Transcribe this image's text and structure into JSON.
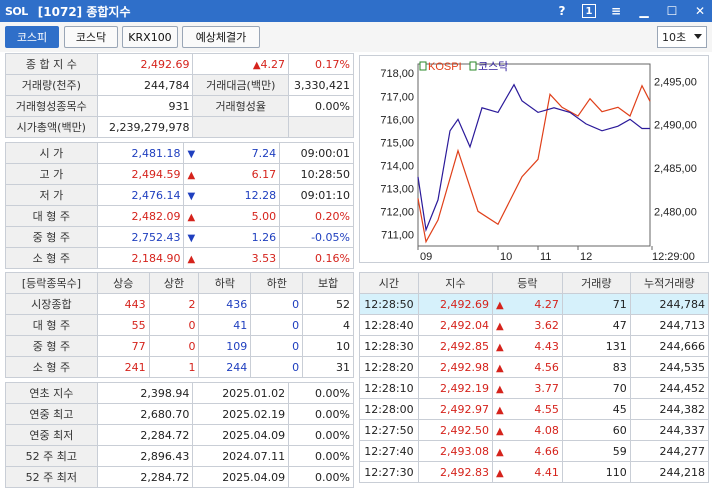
{
  "title": {
    "logo": "SOL",
    "screen": "[1072] 종합지수",
    "help": "?",
    "num": "1",
    "menu": "≡"
  },
  "tabs": [
    {
      "label": "코스피",
      "active": true
    },
    {
      "label": "코스닥"
    },
    {
      "label": "KRX100"
    },
    {
      "label": "예상체결가"
    }
  ],
  "interval": "10초",
  "summary": {
    "index_label": "종 합 지 수",
    "index_value": "2,492.69",
    "index_change": "4.27",
    "index_pct": "0.17%",
    "vol_label": "거래량(천주)",
    "vol_value": "244,784",
    "amt_label": "거래대금(백만)",
    "amt_value": "3,330,421",
    "form_cnt_label": "거래형성종목수",
    "form_cnt_value": "931",
    "form_rate_label": "거래형성율",
    "form_rate_value": "0.00%",
    "mktcap_label": "시가총액(백만)",
    "mktcap_value": "2,239,279,978"
  },
  "prices": [
    {
      "label": "시   가",
      "value": "2,481.18",
      "dir": "down",
      "change": "7.24",
      "time": "09:00:01",
      "vcolor": "blue"
    },
    {
      "label": "고   가",
      "value": "2,494.59",
      "dir": "up",
      "change": "6.17",
      "time": "10:28:50",
      "vcolor": "red"
    },
    {
      "label": "저   가",
      "value": "2,476.14",
      "dir": "down",
      "change": "12.28",
      "time": "09:01:10",
      "vcolor": "blue"
    },
    {
      "label": "대 형 주",
      "value": "2,482.09",
      "dir": "up",
      "change": "5.00",
      "time": "0.20%",
      "vcolor": "red",
      "tcolor": "red"
    },
    {
      "label": "중 형 주",
      "value": "2,752.43",
      "dir": "down",
      "change": "1.26",
      "time": "-0.05%",
      "vcolor": "blue",
      "tcolor": "blue"
    },
    {
      "label": "소 형 주",
      "value": "2,184.90",
      "dir": "up",
      "change": "3.53",
      "time": "0.16%",
      "vcolor": "red",
      "tcolor": "red"
    }
  ],
  "breadth": {
    "headers": [
      "[등락종목수]",
      "상승",
      "상한",
      "하락",
      "하한",
      "보합"
    ],
    "rows": [
      {
        "label": "시장종합",
        "c": [
          "443",
          "2",
          "436",
          "0",
          "52"
        ]
      },
      {
        "label": "대 형 주",
        "c": [
          "55",
          "0",
          "41",
          "0",
          "4"
        ]
      },
      {
        "label": "중 형 주",
        "c": [
          "77",
          "0",
          "109",
          "0",
          "10"
        ]
      },
      {
        "label": "소 형 주",
        "c": [
          "241",
          "1",
          "244",
          "0",
          "31"
        ]
      }
    ]
  },
  "yearly": [
    {
      "label": "연초  지수",
      "value": "2,398.94",
      "date": "2025.01.02",
      "pct": "0.00%"
    },
    {
      "label": "연중  최고",
      "value": "2,680.70",
      "date": "2025.02.19",
      "pct": "0.00%"
    },
    {
      "label": "연중  최저",
      "value": "2,284.72",
      "date": "2025.04.09",
      "pct": "0.00%"
    },
    {
      "label": "52 주 최고",
      "value": "2,896.43",
      "date": "2024.07.11",
      "pct": "0.00%"
    },
    {
      "label": "52 주 최저",
      "value": "2,284.72",
      "date": "2025.04.09",
      "pct": "0.00%"
    }
  ],
  "ticks": {
    "headers": [
      "시간",
      "지수",
      "등락",
      "거래량",
      "누적거래량"
    ],
    "rows": [
      {
        "time": "12:28:50",
        "index": "2,492.69",
        "chg": "4.27",
        "vol": "71",
        "cum": "244,784"
      },
      {
        "time": "12:28:40",
        "index": "2,492.04",
        "chg": "3.62",
        "vol": "47",
        "cum": "244,713"
      },
      {
        "time": "12:28:30",
        "index": "2,492.85",
        "chg": "4.43",
        "vol": "131",
        "cum": "244,666"
      },
      {
        "time": "12:28:20",
        "index": "2,492.98",
        "chg": "4.56",
        "vol": "83",
        "cum": "244,535"
      },
      {
        "time": "12:28:10",
        "index": "2,492.19",
        "chg": "3.77",
        "vol": "70",
        "cum": "244,452"
      },
      {
        "time": "12:28:00",
        "index": "2,492.97",
        "chg": "4.55",
        "vol": "45",
        "cum": "244,382"
      },
      {
        "time": "12:27:50",
        "index": "2,492.50",
        "chg": "4.08",
        "vol": "60",
        "cum": "244,337"
      },
      {
        "time": "12:27:40",
        "index": "2,493.08",
        "chg": "4.66",
        "vol": "59",
        "cum": "244,277"
      },
      {
        "time": "12:27:30",
        "index": "2,492.83",
        "chg": "4.41",
        "vol": "110",
        "cum": "244,218"
      }
    ]
  },
  "chart_data": {
    "type": "line",
    "legend": [
      "KOSPI",
      "코스닥"
    ],
    "left_axis_ticks": [
      "718,00",
      "717,00",
      "716,00",
      "715,00",
      "714,00",
      "713,00",
      "712,00",
      "711,00"
    ],
    "right_axis_ticks": [
      "2,495,00",
      "2,490,00",
      "2,485,00",
      "2,480,00"
    ],
    "x_ticks": [
      "09",
      "10",
      "11",
      "12",
      "12:29:00"
    ],
    "ylim_left": [
      710.5,
      718.4
    ],
    "ylim_right": [
      2476,
      2497
    ],
    "series": [
      {
        "name": "KOSPI",
        "axis": "right",
        "color": "#e0401a",
        "x": [
          0,
          0.2,
          0.5,
          1,
          1.5,
          2,
          2.6,
          3,
          3.3,
          3.6,
          4,
          4.3,
          4.6,
          5,
          5.3,
          5.6,
          5.8
        ],
        "values": [
          2481.5,
          2476.5,
          2479,
          2487,
          2480,
          2478.5,
          2484,
          2486,
          2493.5,
          2492,
          2491,
          2493,
          2491.5,
          2492,
          2491,
          2494.5,
          2492.7
        ]
      },
      {
        "name": "코스닥",
        "axis": "left",
        "color": "#2b1a9a",
        "x": [
          0,
          0.2,
          0.5,
          0.8,
          1,
          1.3,
          1.6,
          2,
          2.4,
          2.6,
          3,
          3.4,
          3.8,
          4.2,
          4.6,
          5,
          5.3,
          5.6,
          5.8
        ],
        "values": [
          713.5,
          711.2,
          712.5,
          715.5,
          716,
          714.8,
          716.5,
          716.3,
          717.5,
          716.8,
          716.3,
          716.5,
          716.3,
          715.8,
          715.5,
          715.7,
          716,
          715.6,
          715.6
        ]
      }
    ]
  }
}
